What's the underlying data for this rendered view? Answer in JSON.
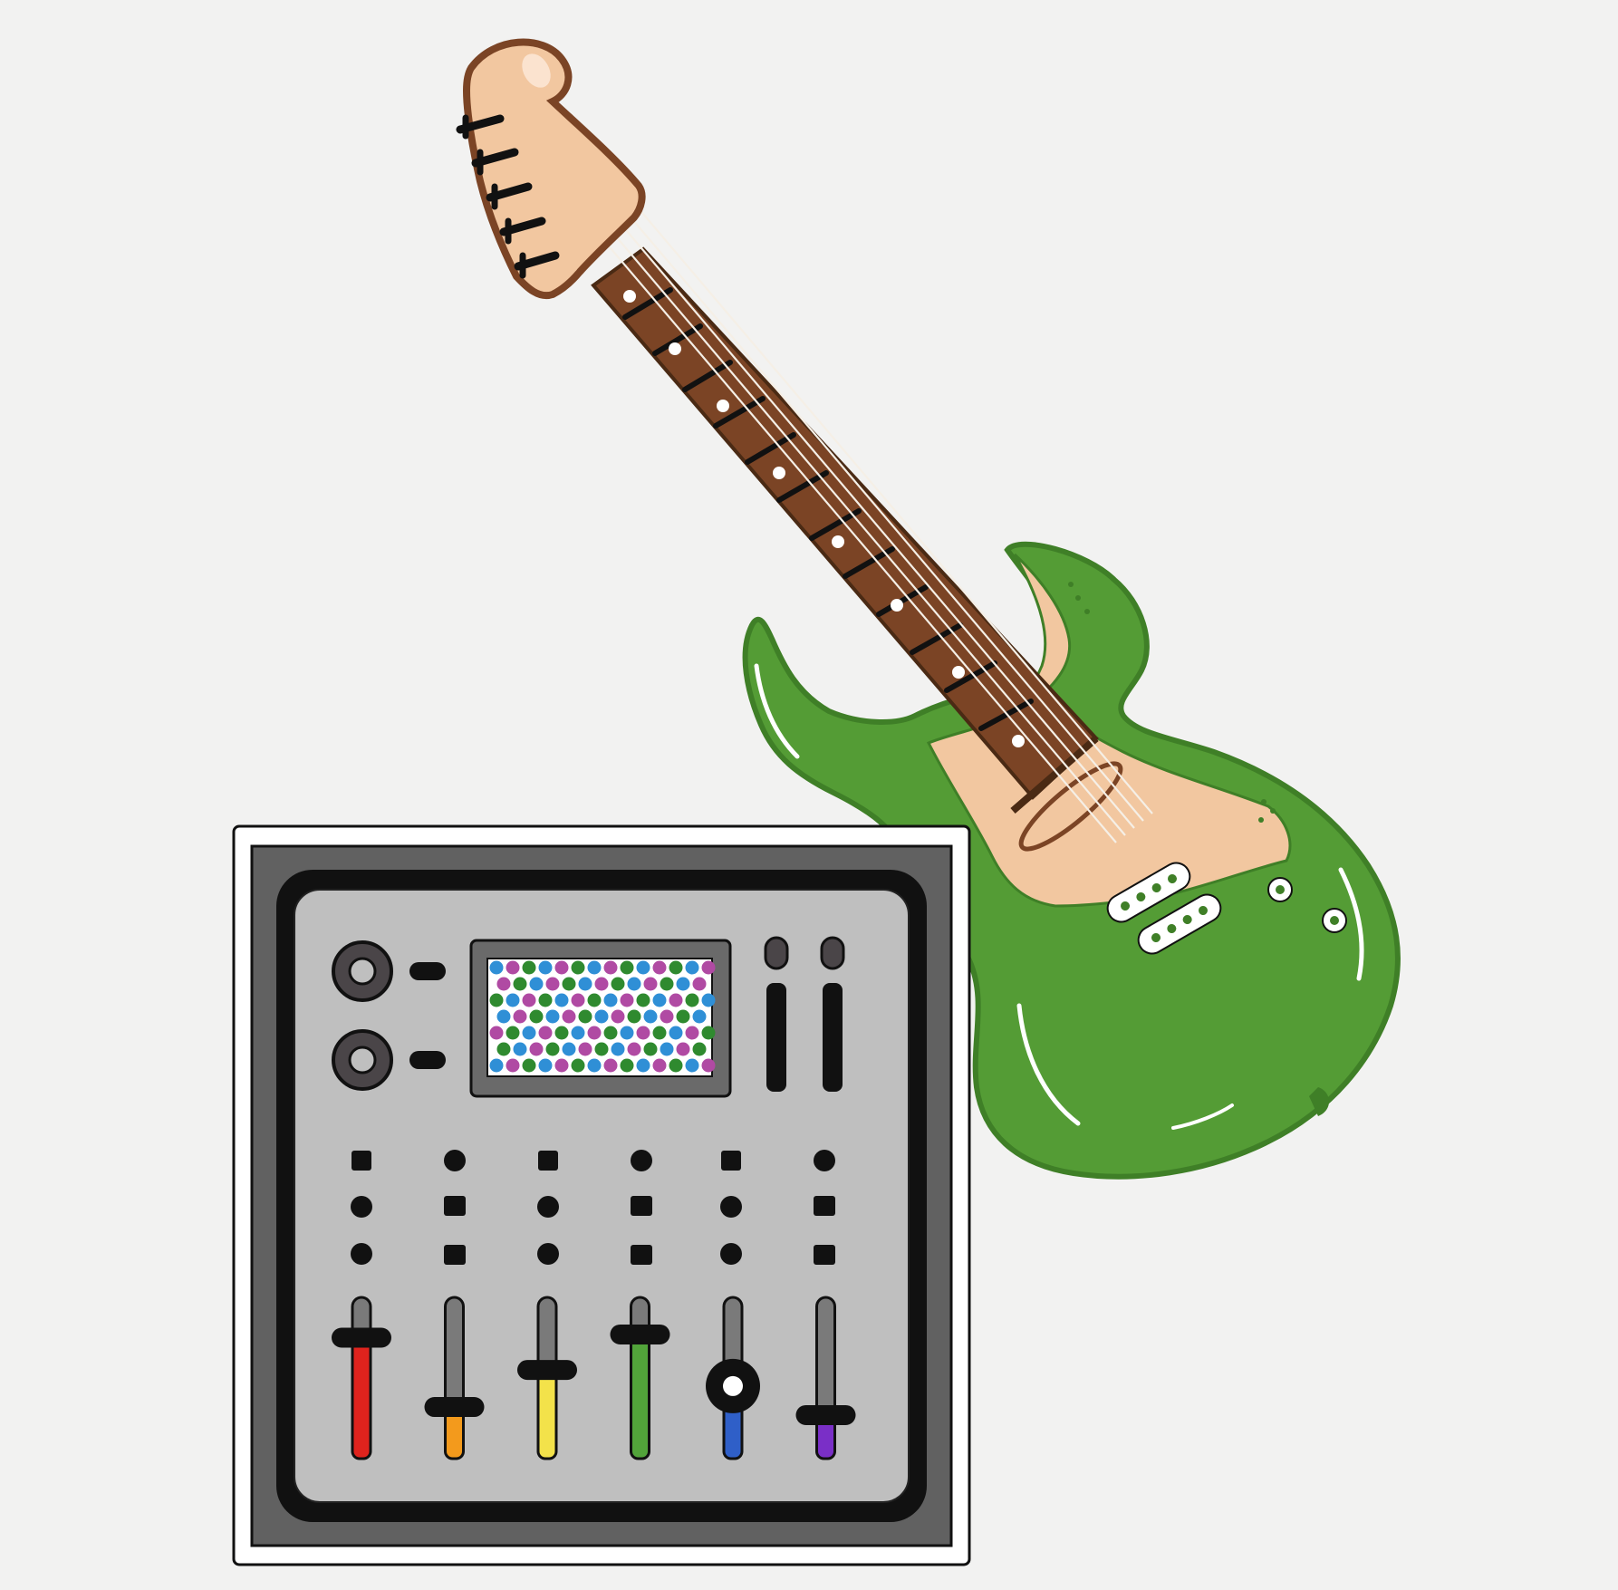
{
  "scene": {
    "subject": "",
    "colors": {
      "background": "#f2f2f1",
      "guitar_body": "#549c35",
      "pickguard": "#f2c7a0",
      "neck": "#7b4425",
      "headstock": "#f2c7a0",
      "outline": "#111111",
      "mixer_frame": "#ffffff",
      "mixer_bezel": "#616161",
      "mixer_panel": "#bfbfbf",
      "screen": "#ffffff"
    },
    "faders": [
      {
        "color": "#e0231d",
        "level": 0.75
      },
      {
        "color": "#f39a1c",
        "level": 0.32
      },
      {
        "color": "#f3e24a",
        "level": 0.55
      },
      {
        "color": "#52a43a",
        "level": 0.77
      },
      {
        "color": "#2f5fc8",
        "level": 0.45
      },
      {
        "color": "#7a2fc7",
        "level": 0.27
      }
    ],
    "screen_dot_colors": [
      "#2f8fd6",
      "#b04aa3",
      "#2f8a2f"
    ]
  }
}
